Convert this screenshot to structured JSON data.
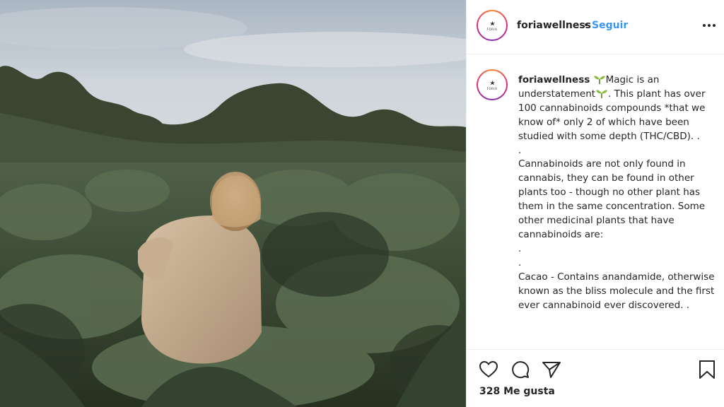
{
  "post": {
    "username": "foriawellness",
    "separator": "•",
    "follow_label": "Seguir",
    "avatar_logo_text": "FORIA"
  },
  "caption": {
    "username": "foriawellness",
    "part1": "Magic is an understatement",
    "part2": ". This plant has over 100 cannabinoids compounds *that we know of* only 2 of which have been studied with some depth (THC/CBD). .\n.\nCannabinoids are not only found in cannabis, they can be found in other plants too - though no other plant has them in the same concentration. Some other medicinal plants that have cannabinoids are:\n.\n.\nCacao - Contains anandamide, otherwise known as the bliss molecule and the first ever cannabinoid ever discovered. ."
  },
  "actions": {
    "likes_label": "328 Me gusta",
    "icons": [
      "heart-icon",
      "comment-icon",
      "share-icon",
      "bookmark-icon",
      "more-options-icon",
      "sprout-emoji-icon"
    ]
  },
  "colors": {
    "link": "#3897f0",
    "text": "#262626",
    "border": "#efefef"
  }
}
